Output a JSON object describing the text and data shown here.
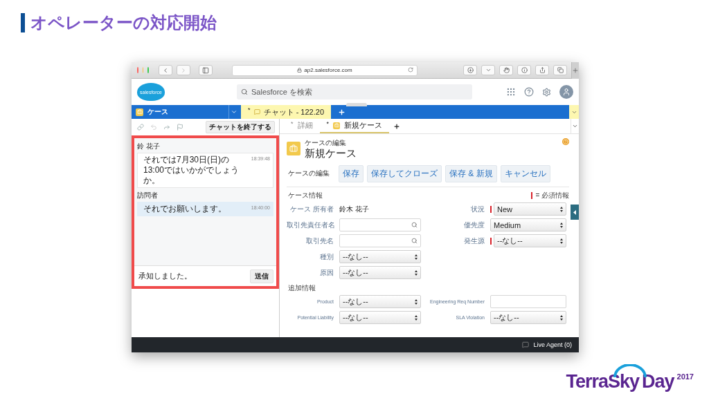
{
  "slide_title": "オペレーターの対応開始",
  "browser": {
    "url": "ap2.salesforce.com"
  },
  "app_header": {
    "logo": "salesforce",
    "search_placeholder": "Salesforce を検索"
  },
  "primary_tabs": [
    {
      "kind": "app",
      "label": "ケース",
      "selected": false
    },
    {
      "kind": "workspace",
      "marker": "*",
      "label": "チャット - 122.20",
      "selected": true
    }
  ],
  "chat": {
    "end_button": "チャットを終了する",
    "messages": [
      {
        "sender": "鈴 花子",
        "text": "それでは7月30日(日)の13:00ではいかがでしょうか。",
        "time": "18:39:48",
        "kind": "agent"
      },
      {
        "sender": "訪問者",
        "text": "それでお願いします。",
        "time": "18:40:00",
        "kind": "visitor"
      }
    ],
    "input_value": "承知しました。",
    "send_button": "送信"
  },
  "subtabs": [
    {
      "marker": "*",
      "label": "詳細",
      "icon": false,
      "selected": false
    },
    {
      "marker": "*",
      "label": "新規ケース",
      "icon": true,
      "selected": true
    }
  ],
  "case_form": {
    "breadcrumb": "ケースの編集",
    "title": "新規ケース",
    "edit_label": "ケースの編集",
    "buttons": [
      "保存",
      "保存してクローズ",
      "保存 & 新規",
      "キャンセル"
    ],
    "sections": [
      {
        "title": "ケース情報",
        "legend": "= 必須情報",
        "rows": [
          {
            "left": {
              "label": "ケース 所有者",
              "kind": "text",
              "value": "鈴木 花子"
            },
            "right": {
              "label": "状況",
              "kind": "select",
              "value": "New",
              "required": true
            }
          },
          {
            "left": {
              "label": "取引先責任者名",
              "kind": "lookup"
            },
            "right": {
              "label": "優先度",
              "kind": "select",
              "value": "Medium",
              "required": false
            }
          },
          {
            "left": {
              "label": "取引先名",
              "kind": "lookup"
            },
            "right": {
              "label": "発生源",
              "kind": "select",
              "value": "--なし--",
              "required": true
            }
          },
          {
            "left": {
              "label": "種別",
              "kind": "select",
              "value": "--なし--",
              "required": false
            }
          },
          {
            "left": {
              "label": "原因",
              "kind": "select",
              "value": "--なし--",
              "required": false
            }
          }
        ]
      },
      {
        "title": "追加情報",
        "rows": [
          {
            "left": {
              "label": "Product",
              "kind": "select",
              "value": "--なし--",
              "required": false
            },
            "right": {
              "label": "Engineering Req Number",
              "kind": "input"
            }
          },
          {
            "left": {
              "label": "Potential Liability",
              "kind": "select",
              "value": "--なし--",
              "required": false
            },
            "right": {
              "label": "SLA Violation",
              "kind": "select",
              "value": "--なし--",
              "required": false
            }
          }
        ]
      }
    ]
  },
  "footer": {
    "label": "Live Agent (0)"
  },
  "event_logo": {
    "name": "TerraSky",
    "suffix": "Day",
    "year": "2017"
  }
}
